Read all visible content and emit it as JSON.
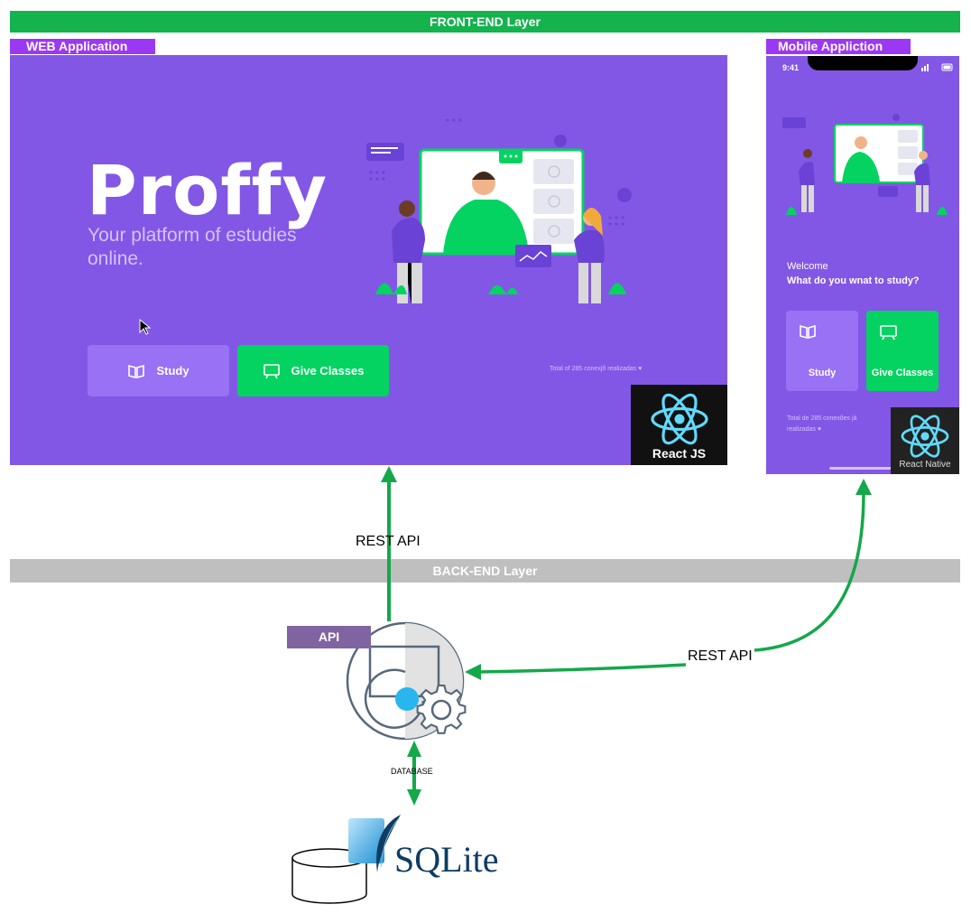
{
  "layers": {
    "front": "FRONT-END Layer",
    "back": "BACK-END Layer"
  },
  "tags": {
    "web": "WEB Application",
    "mobile": "Mobile Appliction",
    "api": "API"
  },
  "web_app": {
    "logo": "Proffy",
    "tagline": "Your platform of estudies online.",
    "study_label": "Study",
    "give_classes_label": "Give Classes",
    "total_text": "Total of 285 conexjõ realizadas",
    "badge": "React JS"
  },
  "mobile_app": {
    "time": "9:41",
    "welcome": "Welcome",
    "question": "What do you wnat to study?",
    "study_label": "Study",
    "give_classes_label": "Give Classes",
    "total_text": "Total de 285 conexões já realizadas",
    "badge": "React Native"
  },
  "connections": {
    "web_api_label": "REST API",
    "mobile_api_label": "REST API",
    "database_label": "DATABASE"
  },
  "database": {
    "name": "SQLite"
  },
  "colors": {
    "front_bar": "#14b34d",
    "back_bar": "#bfbfbf",
    "tag_purple": "#9b38f4",
    "app_purple": "#8257e5",
    "button_green": "#04d361",
    "arrow_green": "#14a84a",
    "api_tag": "#8064a2",
    "react_cyan": "#61dafb"
  },
  "icons": [
    "book-icon",
    "screen-icon",
    "react-logo-icon",
    "api-gear-icon",
    "database-cylinder-icon",
    "sqlite-feather-icon",
    "cursor-icon",
    "heart-icon"
  ]
}
